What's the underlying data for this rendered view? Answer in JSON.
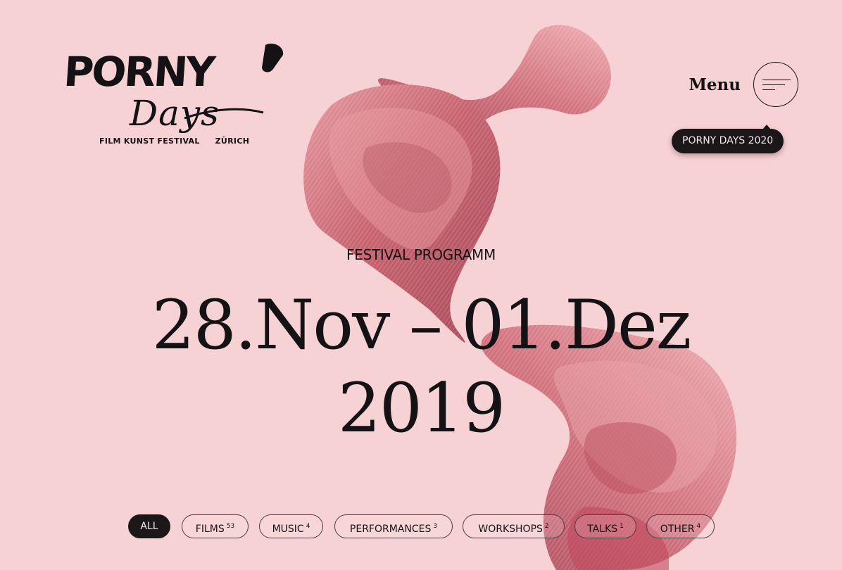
{
  "colors": {
    "background": "#f7d2d4",
    "ink": "#141214",
    "ribbon_dark": "#b85a66",
    "ribbon_mid": "#d57b85",
    "ribbon_light": "#eea8ae"
  },
  "logo": {
    "word_top": "PORNY",
    "word_script": "Days",
    "tagline_left": "FILM KUNST FESTIVAL",
    "tagline_right": "ZÜRICH"
  },
  "header": {
    "menu_label": "Menu",
    "menu_icon": "hamburger-menu-icon",
    "badge_label": "PORNY DAYS 2020"
  },
  "hero": {
    "kicker": "FESTIVAL PROGRAMM",
    "dates": "28.Nov – 01.Dez",
    "year": "2019"
  },
  "filters": [
    {
      "label": "ALL",
      "count": "",
      "active": true
    },
    {
      "label": "FILMS",
      "count": "53",
      "active": false
    },
    {
      "label": "MUSIC",
      "count": "4",
      "active": false
    },
    {
      "label": "PERFORMANCES",
      "count": "3",
      "active": false
    },
    {
      "label": "WORKSHOPS",
      "count": "2",
      "active": false
    },
    {
      "label": "TALKS",
      "count": "1",
      "active": false
    },
    {
      "label": "OTHER",
      "count": "4",
      "active": false
    }
  ]
}
